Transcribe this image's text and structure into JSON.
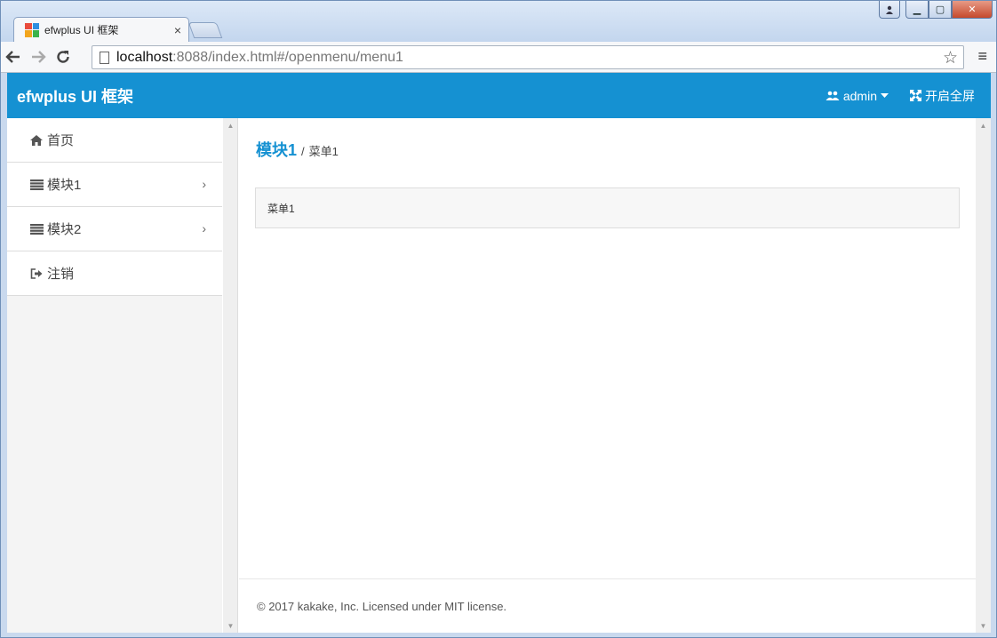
{
  "browser": {
    "tab_title": "efwplus UI 框架",
    "tab_close": "×",
    "url_host": "localhost",
    "url_rest": ":8088/index.html#/openmenu/menu1",
    "window_user_icon": "user-icon",
    "window_min": "▁",
    "window_max": "▢",
    "window_close": "✕"
  },
  "header": {
    "brand": "efwplus UI 框架",
    "user_label": "admin",
    "fullscreen_label": "开启全屏"
  },
  "sidebar": {
    "items": [
      {
        "label": "首页",
        "icon": "home-icon"
      },
      {
        "label": "模块1",
        "icon": "list-icon",
        "has_submenu": true
      },
      {
        "label": "模块2",
        "icon": "list-icon",
        "has_submenu": true
      },
      {
        "label": "注销",
        "icon": "sign-out-icon"
      }
    ],
    "chevron": "›"
  },
  "main": {
    "breadcrumb_main": "模块1",
    "breadcrumb_sep": "/",
    "breadcrumb_sub": "菜单1",
    "panel_text": "菜单1",
    "footer_text": "© 2017 kakake, Inc. Licensed under MIT license."
  },
  "colors": {
    "accent": "#1591d2",
    "sidebar_bg": "#f4f4f4"
  }
}
